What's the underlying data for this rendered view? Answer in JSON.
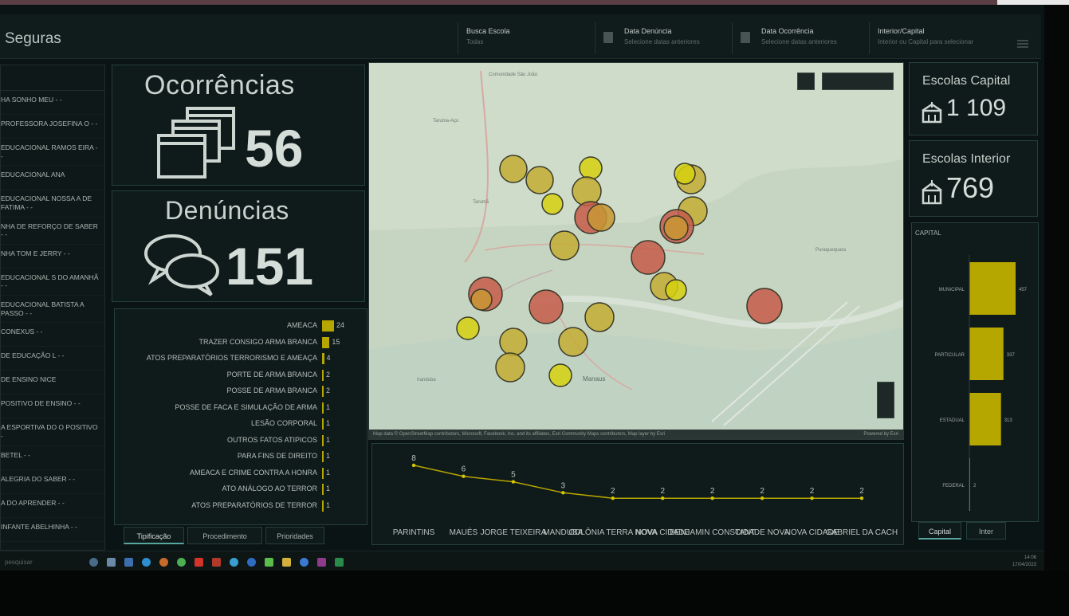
{
  "header": {
    "title": "Seguras",
    "filters": [
      {
        "label": "Busca Escola",
        "placeholder": "Todas"
      },
      {
        "label": "Data Denúncia",
        "placeholder": "Selecione datas anteriores"
      },
      {
        "label": "Data Ocorrência",
        "placeholder": "Selecione datas anteriores"
      },
      {
        "label": "Interior/Capital",
        "placeholder": "Interior ou Capital para selecionar"
      }
    ]
  },
  "school_list": [
    "HA SONHO MEU - -",
    "PROFESSORA JOSEFINA O - -",
    "EDUCACIONAL RAMOS EIRA - -",
    "EDUCACIONAL ANA",
    "EDUCACIONAL NOSSA A DE FATIMA - -",
    "NHA DE REFORÇO DE SABER - -",
    "NHA TOM E JERRY - -",
    "EDUCACIONAL S DO AMANHÃ - -",
    "EDUCACIONAL BATISTA A PASSO - -",
    "CONEXUS - -",
    "DE EDUCAÇÃO L - -",
    "DE ENSINO NICE",
    "POSITIVO DE ENSINO - -",
    "A ESPORTIVA DO O POSITIVO -",
    "BETEL - -",
    "ALEGRIA DO SABER - -",
    "A DO APRENDER - -",
    "INFANTE ABELHINHA - -"
  ],
  "ocorrencias": {
    "title": "Ocorrências",
    "value": "56"
  },
  "denuncias": {
    "title": "Denúncias",
    "value": "151"
  },
  "tipificacao": {
    "rows": [
      {
        "label": "AMEACA",
        "count": 24
      },
      {
        "label": "TRAZER CONSIGO ARMA BRANCA",
        "count": 15
      },
      {
        "label": "ATOS PREPARATÓRIOS TERRORISMO E AMEAÇA",
        "count": 4
      },
      {
        "label": "PORTE DE ARMA BRANCA",
        "count": 2
      },
      {
        "label": "POSSE DE ARMA BRANCA",
        "count": 2
      },
      {
        "label": "POSSE DE FACA E SIMULAÇÃO DE ARMA",
        "count": 1
      },
      {
        "label": "LESÃO CORPORAL",
        "count": 1
      },
      {
        "label": "OUTROS FATOS ATIPICOS",
        "count": 1
      },
      {
        "label": "PARA FINS DE DIREITO",
        "count": 1
      },
      {
        "label": "AMEACA E CRIME CONTRA A HONRA",
        "count": 1
      },
      {
        "label": "ATO ANÁLOGO AO TERROR",
        "count": 1
      },
      {
        "label": "ATOS PREPARATÓRIOS DE TERROR",
        "count": 1
      }
    ],
    "tabs": [
      "Tipificação",
      "Procedimento",
      "Prioridades"
    ]
  },
  "map": {
    "attribution": "Map data © OpenStreetMap contributors, Microsoft, Facebook, Inc. and its affiliates, Esri Community Maps contributors, Map layer by Esri",
    "powered": "Powered by Esri",
    "places": [
      "Comunidade São João",
      "Taruma-Açu",
      "Tarumã",
      "Manaus",
      "Puraquequara",
      "Iranduba"
    ]
  },
  "chart_data": {
    "type": "line",
    "categories": [
      "PARINTINS",
      "MAUÉS",
      "JORGE TEIXEIRA",
      "MANDUBA",
      "COLÔNIA TERRA NOVA",
      "NOVA CIDADE",
      "BENJAMIN CONSTANT",
      "CIDADE NOVA",
      "NOVA CIDADE",
      "GABRIEL DA CACH"
    ],
    "axis_labels": [
      "PARINTINS",
      "MAUÉS",
      "JORGE TEIXEIRA",
      "MANDUBA",
      "COLÔNIA TERRA NOVA",
      "NOVA CIDADE",
      "BENJAMIN CONSTANT",
      "CIDADE NOVA",
      "NOVA CIDADE",
      "GABRIEL DA CACH"
    ],
    "values": [
      8,
      6,
      5,
      3,
      2,
      2,
      2,
      2,
      2,
      2
    ],
    "ylim": [
      0,
      9
    ]
  },
  "escolas_capital": {
    "title": "Escolas Capital",
    "value": "1 109"
  },
  "escolas_interior": {
    "title": "Escolas Interior",
    "value": "769"
  },
  "capital_chart": {
    "title": "CAPITAL",
    "bars": [
      {
        "label": "MUNICIPAL",
        "value": 457
      },
      {
        "label": "PARTICULAR",
        "value": 337
      },
      {
        "label": "ESTADUAL",
        "value": 313
      },
      {
        "label": "FEDERAL",
        "value": 2
      }
    ],
    "tabs": [
      "Capital",
      "Inter"
    ]
  },
  "taskbar": {
    "search_placeholder": "pesquisar",
    "time": "14:06",
    "date": "17/04/2023"
  }
}
